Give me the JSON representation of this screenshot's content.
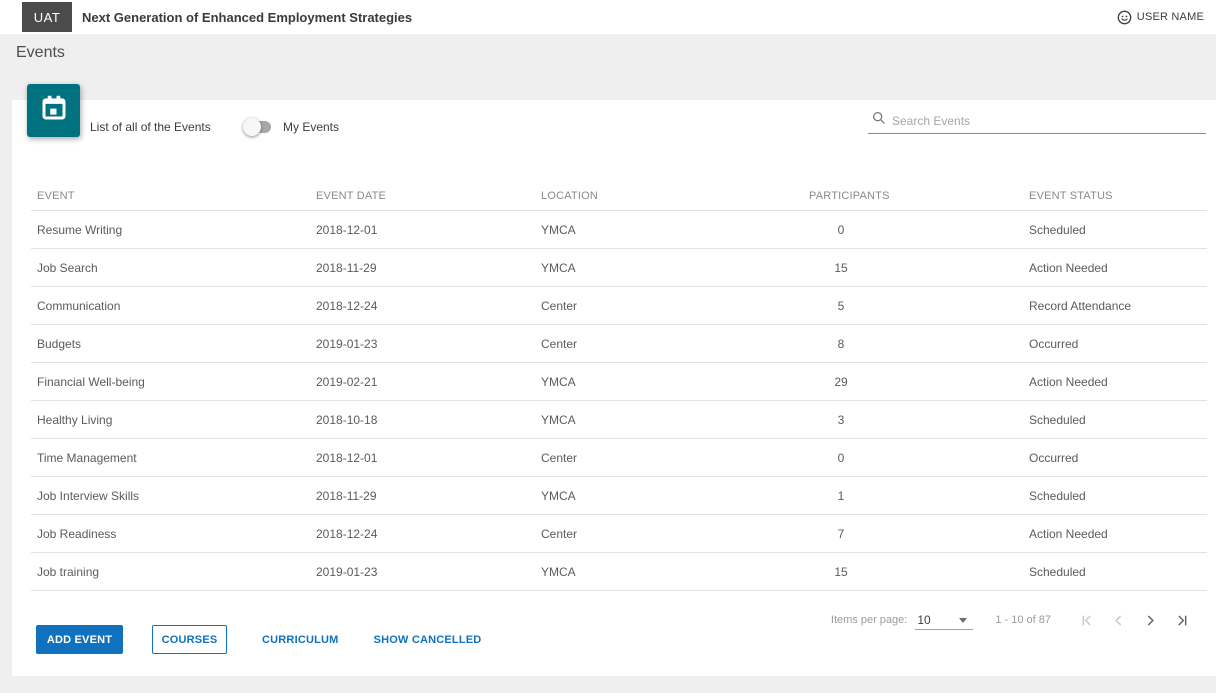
{
  "header": {
    "env_badge": "UAT",
    "app_title": "Next Generation of Enhanced Employment Strategies",
    "user_name": "USER NAME"
  },
  "page": {
    "title": "Events",
    "subtitle": "List of all of the Events",
    "my_events_label": "My Events",
    "my_events_state": "off",
    "search_placeholder": "Search Events"
  },
  "icons": {
    "tile": "calendar-icon",
    "search": "search-icon",
    "user": "user-icon",
    "page_size_caret": "chevron-down-icon",
    "pager": [
      "first-page-icon",
      "previous-page-icon",
      "next-page-icon",
      "last-page-icon"
    ]
  },
  "table": {
    "columns": [
      "EVENT",
      "EVENT DATE",
      "LOCATION",
      "PARTICIPANTS",
      "EVENT STATUS"
    ],
    "rows": [
      {
        "event": "Resume Writing",
        "date": "2018-12-01",
        "location": "YMCA",
        "participants": "0",
        "status": "Scheduled"
      },
      {
        "event": "Job Search",
        "date": "2018-11-29",
        "location": "YMCA",
        "participants": "15",
        "status": "Action Needed"
      },
      {
        "event": "Communication",
        "date": "2018-12-24",
        "location": "Center",
        "participants": "5",
        "status": "Record Attendance"
      },
      {
        "event": "Budgets",
        "date": "2019-01-23",
        "location": "Center",
        "participants": "8",
        "status": "Occurred"
      },
      {
        "event": "Financial Well-being",
        "date": "2019-02-21",
        "location": "YMCA",
        "participants": "29",
        "status": "Action Needed"
      },
      {
        "event": "Healthy Living",
        "date": "2018-10-18",
        "location": "YMCA",
        "participants": "3",
        "status": "Scheduled"
      },
      {
        "event": "Time Management",
        "date": "2018-12-01",
        "location": "Center",
        "participants": "0",
        "status": "Occurred"
      },
      {
        "event": "Job Interview Skills",
        "date": "2018-11-29",
        "location": "YMCA",
        "participants": "1",
        "status": "Scheduled"
      },
      {
        "event": "Job Readiness",
        "date": "2018-12-24",
        "location": "Center",
        "participants": "7",
        "status": "Action Needed"
      },
      {
        "event": "Job training",
        "date": "2019-01-23",
        "location": "YMCA",
        "participants": "15",
        "status": "Scheduled"
      }
    ]
  },
  "pagination": {
    "items_per_page_label": "Items per page:",
    "page_size": "10",
    "range": "1 - 10 of 87"
  },
  "footer": {
    "add_event": "ADD EVENT",
    "courses": "COURSES",
    "curriculum": "CURRICULUM",
    "show_cancelled": "SHOW CANCELLED"
  },
  "colors": {
    "accent_teal": "#00717F",
    "primary_blue": "#1072BE",
    "badge_gray": "#4B4B4B",
    "page_background": "#EFEFEF"
  }
}
